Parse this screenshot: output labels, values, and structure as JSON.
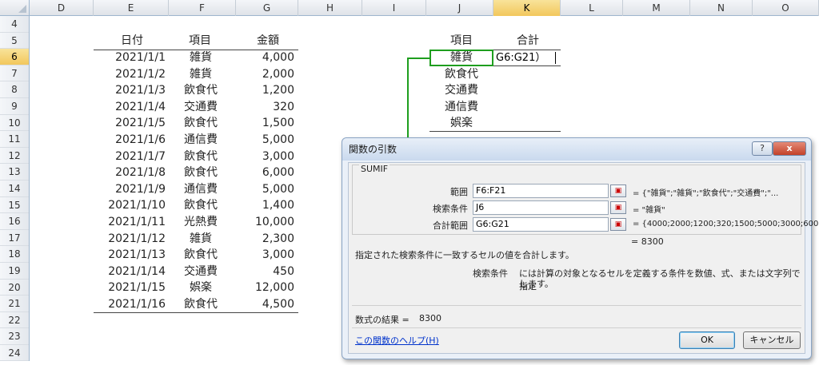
{
  "columns": [
    "D",
    "E",
    "F",
    "G",
    "H",
    "I",
    "J",
    "K",
    "L",
    "M",
    "N",
    "O"
  ],
  "selected_column": "K",
  "rows": [
    "4",
    "5",
    "6",
    "7",
    "8",
    "9",
    "10",
    "11",
    "12",
    "13",
    "14",
    "15",
    "16",
    "17",
    "18",
    "19",
    "20",
    "21",
    "22",
    "23",
    "24"
  ],
  "selected_row": "6",
  "table": {
    "headers": {
      "date": "日付",
      "item": "項目",
      "amount": "金額"
    },
    "records": [
      {
        "date": "2021/1/1",
        "item": "雑貨",
        "amount": "4,000"
      },
      {
        "date": "2021/1/2",
        "item": "雑貨",
        "amount": "2,000"
      },
      {
        "date": "2021/1/3",
        "item": "飲食代",
        "amount": "1,200"
      },
      {
        "date": "2021/1/4",
        "item": "交通費",
        "amount": "320"
      },
      {
        "date": "2021/1/5",
        "item": "飲食代",
        "amount": "1,500"
      },
      {
        "date": "2021/1/6",
        "item": "通信費",
        "amount": "5,000"
      },
      {
        "date": "2021/1/7",
        "item": "飲食代",
        "amount": "3,000"
      },
      {
        "date": "2021/1/8",
        "item": "飲食代",
        "amount": "6,000"
      },
      {
        "date": "2021/1/9",
        "item": "通信費",
        "amount": "5,000"
      },
      {
        "date": "2021/1/10",
        "item": "飲食代",
        "amount": "1,400"
      },
      {
        "date": "2021/1/11",
        "item": "光熱費",
        "amount": "10,000"
      },
      {
        "date": "2021/1/12",
        "item": "雑貨",
        "amount": "2,300"
      },
      {
        "date": "2021/1/13",
        "item": "飲食代",
        "amount": "3,000"
      },
      {
        "date": "2021/1/14",
        "item": "交通費",
        "amount": "450"
      },
      {
        "date": "2021/1/15",
        "item": "娯楽",
        "amount": "12,000"
      },
      {
        "date": "2021/1/16",
        "item": "飲食代",
        "amount": "4,500"
      }
    ]
  },
  "summary": {
    "headers": {
      "item": "項目",
      "total": "合計"
    },
    "items": [
      "雑貨",
      "飲食代",
      "交通費",
      "通信費",
      "娯楽"
    ],
    "k6_text": "G6:G21）"
  },
  "dialog": {
    "title": "関数の引数",
    "help_glyph": "?",
    "close_glyph": "x",
    "function_name": "SUMIF",
    "args": [
      {
        "label": "範囲",
        "value": "F6:F21",
        "result": "= {\"雑貨\";\"雑貨\";\"飲食代\";\"交通費\";\"..."
      },
      {
        "label": "検索条件",
        "value": "J6",
        "result": "= \"雑貨\""
      },
      {
        "label": "合計範囲",
        "value": "G6:G21",
        "result": "= {4000;2000;1200;320;1500;5000;3000;600"
      }
    ],
    "function_result": "= 8300",
    "description": "指定された検索条件に一致するセルの値を合計します。",
    "arg_help_name": "検索条件",
    "arg_help_text_1": "には計算の対象となるセルを定義する条件を数値、式、または文字列で指定",
    "arg_help_text_2": "します。",
    "formula_result_label": "数式の結果 =",
    "formula_result_value": "8300",
    "help_link": "この関数のヘルプ(H)",
    "ok_label": "OK",
    "cancel_label": "キャンセル"
  },
  "colors": {
    "highlight": "#1e9e1e",
    "link": "#0033cc"
  }
}
